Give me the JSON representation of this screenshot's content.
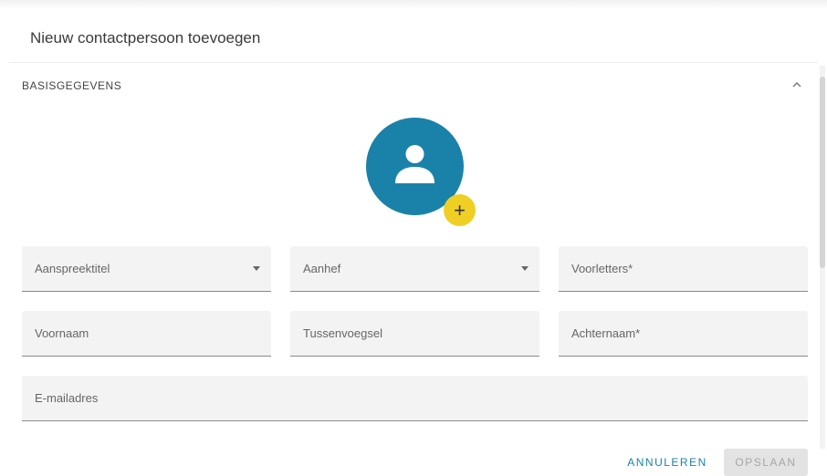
{
  "dialog": {
    "title": "Nieuw contactpersoon toevoegen"
  },
  "section": {
    "title": "BASISGEGEVENS",
    "collapse_icon": "chevron-up-icon"
  },
  "avatar": {
    "icon": "person-icon",
    "add_icon": "plus-icon",
    "add_label": "+",
    "color": "#1a82a8",
    "add_color": "#f0cf25"
  },
  "form": {
    "aanspreektitel": {
      "placeholder": "Aanspreektitel",
      "value": ""
    },
    "aanhef": {
      "placeholder": "Aanhef",
      "value": ""
    },
    "voorletters": {
      "placeholder": "Voorletters*",
      "value": ""
    },
    "voornaam": {
      "placeholder": "Voornaam",
      "value": ""
    },
    "tussenvoegsel": {
      "placeholder": "Tussenvoegsel",
      "value": ""
    },
    "achternaam": {
      "placeholder": "Achternaam*",
      "value": ""
    },
    "email": {
      "placeholder": "E-mailadres",
      "value": ""
    }
  },
  "actions": {
    "cancel_label": "ANNULEREN",
    "save_label": "OPSLAAN",
    "accent_color": "#1a82a8"
  }
}
